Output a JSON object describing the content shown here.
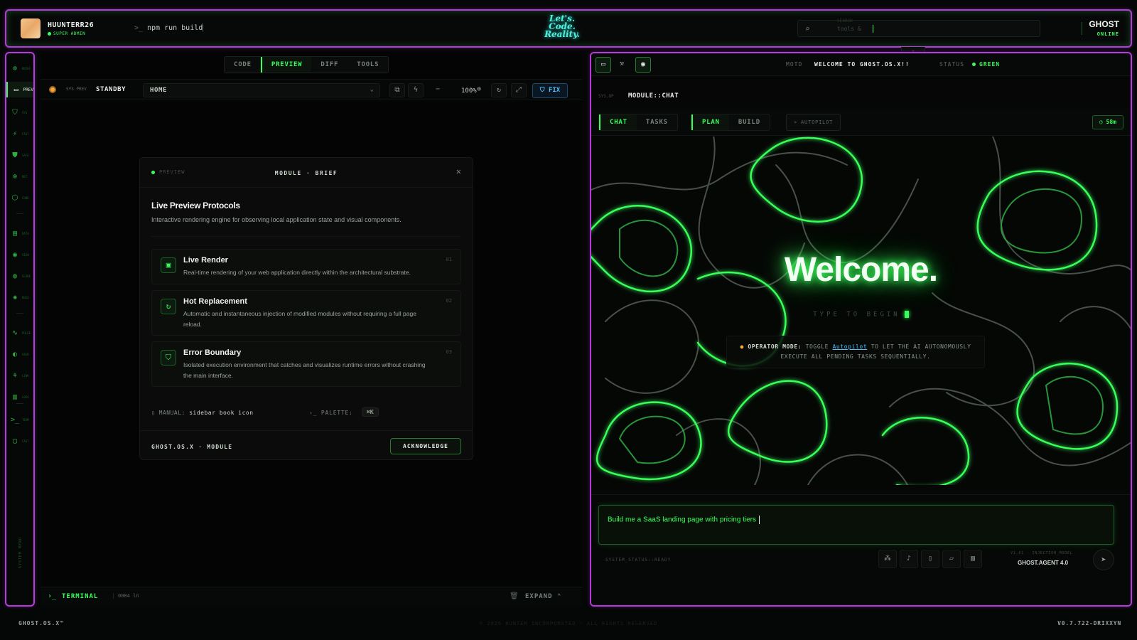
{
  "topbar": {
    "username": "HUUNTERR26",
    "role": "SUPER ADMIN",
    "prompt_symbol": ">_",
    "command": "npm run build",
    "logo_lines": [
      "Let's.",
      "Code.",
      "Reality."
    ],
    "search_hint": "SEARCH",
    "search_value": "tools &",
    "brand": "GHOST",
    "brand_status": "ONLINE"
  },
  "rail": {
    "items": [
      {
        "icon": "⊕",
        "label": "BRIEF"
      },
      {
        "icon": "▭",
        "label": "PREV"
      },
      {
        "icon": "⛉",
        "label": "SYS"
      },
      {
        "icon": "⚡",
        "label": "FAST"
      },
      {
        "icon": "⛊",
        "label": "SAFE"
      },
      {
        "icon": "⊗",
        "label": "NET"
      },
      {
        "icon": "⬡",
        "label": "CUBE"
      },
      {
        "icon": "▤",
        "label": "DATA"
      },
      {
        "icon": "◉",
        "label": "VIEW"
      },
      {
        "icon": "◍",
        "label": "GLOBE"
      },
      {
        "icon": "✺",
        "label": "BUGS"
      },
      {
        "icon": "∿",
        "label": "PULSE"
      },
      {
        "icon": "◐",
        "label": "USER"
      },
      {
        "icon": "⚘",
        "label": "LINK"
      },
      {
        "icon": "▥",
        "label": "LOGS"
      },
      {
        "icon": ">_",
        "label": "TERM"
      },
      {
        "icon": "▢",
        "label": "CAST"
      }
    ],
    "vertical_label": "SYSTEM MENU"
  },
  "left": {
    "tabs": [
      "CODE",
      "PREVIEW",
      "DIFF",
      "TOOLS"
    ],
    "active_tab": "PREVIEW",
    "sys_prev": "SYS.PREV",
    "state": "STANDBY",
    "route": "HOME",
    "zoom": "100%",
    "fix_label": "FIX",
    "card": {
      "tag": "PREVIEW",
      "module": "MODULE · BRIEF",
      "title": "Live Preview Protocols",
      "desc": "Interactive rendering engine for observing local application state and visual components.",
      "features": [
        {
          "name": "Live Render",
          "desc": "Real-time rendering of your web application directly within the architectural substrate.",
          "num": "01"
        },
        {
          "name": "Hot Replacement",
          "desc": "Automatic and instantaneous injection of modified modules without requiring a full page reload.",
          "num": "02"
        },
        {
          "name": "Error Boundary",
          "desc": "Isolated execution environment that catches and visualizes runtime errors without crashing the main interface.",
          "num": "03"
        }
      ],
      "manual_label": "MANUAL:",
      "manual_value": "sidebar book icon",
      "palette_label": "PALETTE:",
      "palette_key": "⌘K",
      "brand": "GHOST.OS.X · MODULE",
      "ack": "ACKNOWLEDGE"
    },
    "terminal": {
      "label": "TERMINAL",
      "lines": "0084 ln",
      "expand": "EXPAND"
    }
  },
  "right": {
    "motd_label": "MOTD",
    "motd": "WELCOME TO GHOST.OS.X!!",
    "status_label": "STATUS",
    "status": "GREEN",
    "sysop": "SYS.OP",
    "module": "MODULE::CHAT",
    "tabs_a": [
      "CHAT",
      "TASKS"
    ],
    "tabs_b": [
      "PLAN",
      "BUILD"
    ],
    "autopilot": "» AUTOPILOT",
    "timer": "58m",
    "welcome": "Welcome.",
    "type_hint": "TYPE TO BEGIN",
    "opmode_label": "OPERATOR MODE:",
    "opmode_pre": "TOGGLE",
    "opmode_link": "Autopilot",
    "opmode_post": "TO LET THE AI AUTONOMOUSLY",
    "opmode_line2": "EXECUTE ALL PENDING TASKS SEQUENTIALLY.",
    "prompt": "Build me a SaaS landing page with pricing tiers",
    "system_status": "SYSTEM_STATUS::READY",
    "model_label": "V1.01 · INJECTION_MODEL",
    "model": "GHOST.AGENT 4.0"
  },
  "footer": {
    "left": "GHOST.OS.X™",
    "mid": "© 2026 HUNTER INCORPORATED · ALL RIGHTS RESERVED",
    "right": "V0.7.722-DRIXXYN"
  },
  "colors": {
    "accent": "#39ff5a",
    "frame": "#b83adf",
    "info": "#4fc2ff",
    "warn": "#f3a83a"
  }
}
